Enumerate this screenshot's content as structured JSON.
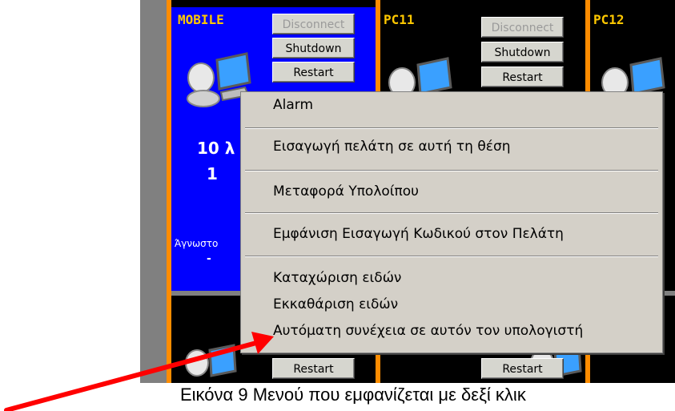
{
  "tiles": {
    "mobile": {
      "label": "MOBILE",
      "disconnect_label": "Disconnect",
      "shutdown_label": "Shutdown",
      "restart_label": "Restart",
      "time_partial": "10 λ",
      "count": "1",
      "status_partial": "Άγνωστο",
      "status_dash": "-"
    },
    "pc11": {
      "label": "PC11",
      "disconnect_label": "Disconnect",
      "shutdown_label": "Shutdown",
      "restart_label": "Restart"
    },
    "pc12": {
      "label": "PC12"
    },
    "bottom_left": {
      "restart_label": "Restart"
    },
    "bottom_right": {
      "restart_label": "Restart"
    }
  },
  "context_menu": {
    "items": [
      "Alarm",
      "Εισαγωγή πελάτη σε αυτή τη θέση",
      "Μεταφορά Υπολοίπου",
      "Εμφάνιση Εισαγωγή Κωδικού στον Πελάτη",
      "Καταχώριση ειδών",
      "Εκκαθάριση ειδών",
      "Αυτόματη συνέχεια σε αυτόν τον υπολογιστή"
    ]
  },
  "caption": "Εικόνα 9 Μενού που εμφανίζεται με δεξί κλικ",
  "colors": {
    "mobile_tile_bg": "#0000ff",
    "label_yellow": "#ffc800",
    "orange_border": "#ff8c00",
    "menu_bg": "#d4d0c8",
    "arrow_red": "#ff0000"
  },
  "icons": [
    "computer-user-icon"
  ]
}
